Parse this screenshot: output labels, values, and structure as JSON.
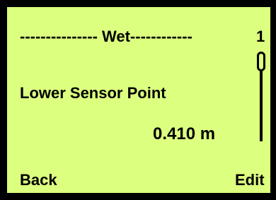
{
  "screen": {
    "header": "--------------- Wet------------",
    "page_number": "1",
    "parameter_label": "Lower Sensor Point",
    "parameter_value": "0.410 m"
  },
  "softkeys": {
    "left_label": "Back",
    "right_label": "Edit"
  },
  "scrollbar": {
    "position": 0
  },
  "colors": {
    "display_background": "#ddff7f",
    "text": "#000000",
    "frame": "#000000"
  }
}
